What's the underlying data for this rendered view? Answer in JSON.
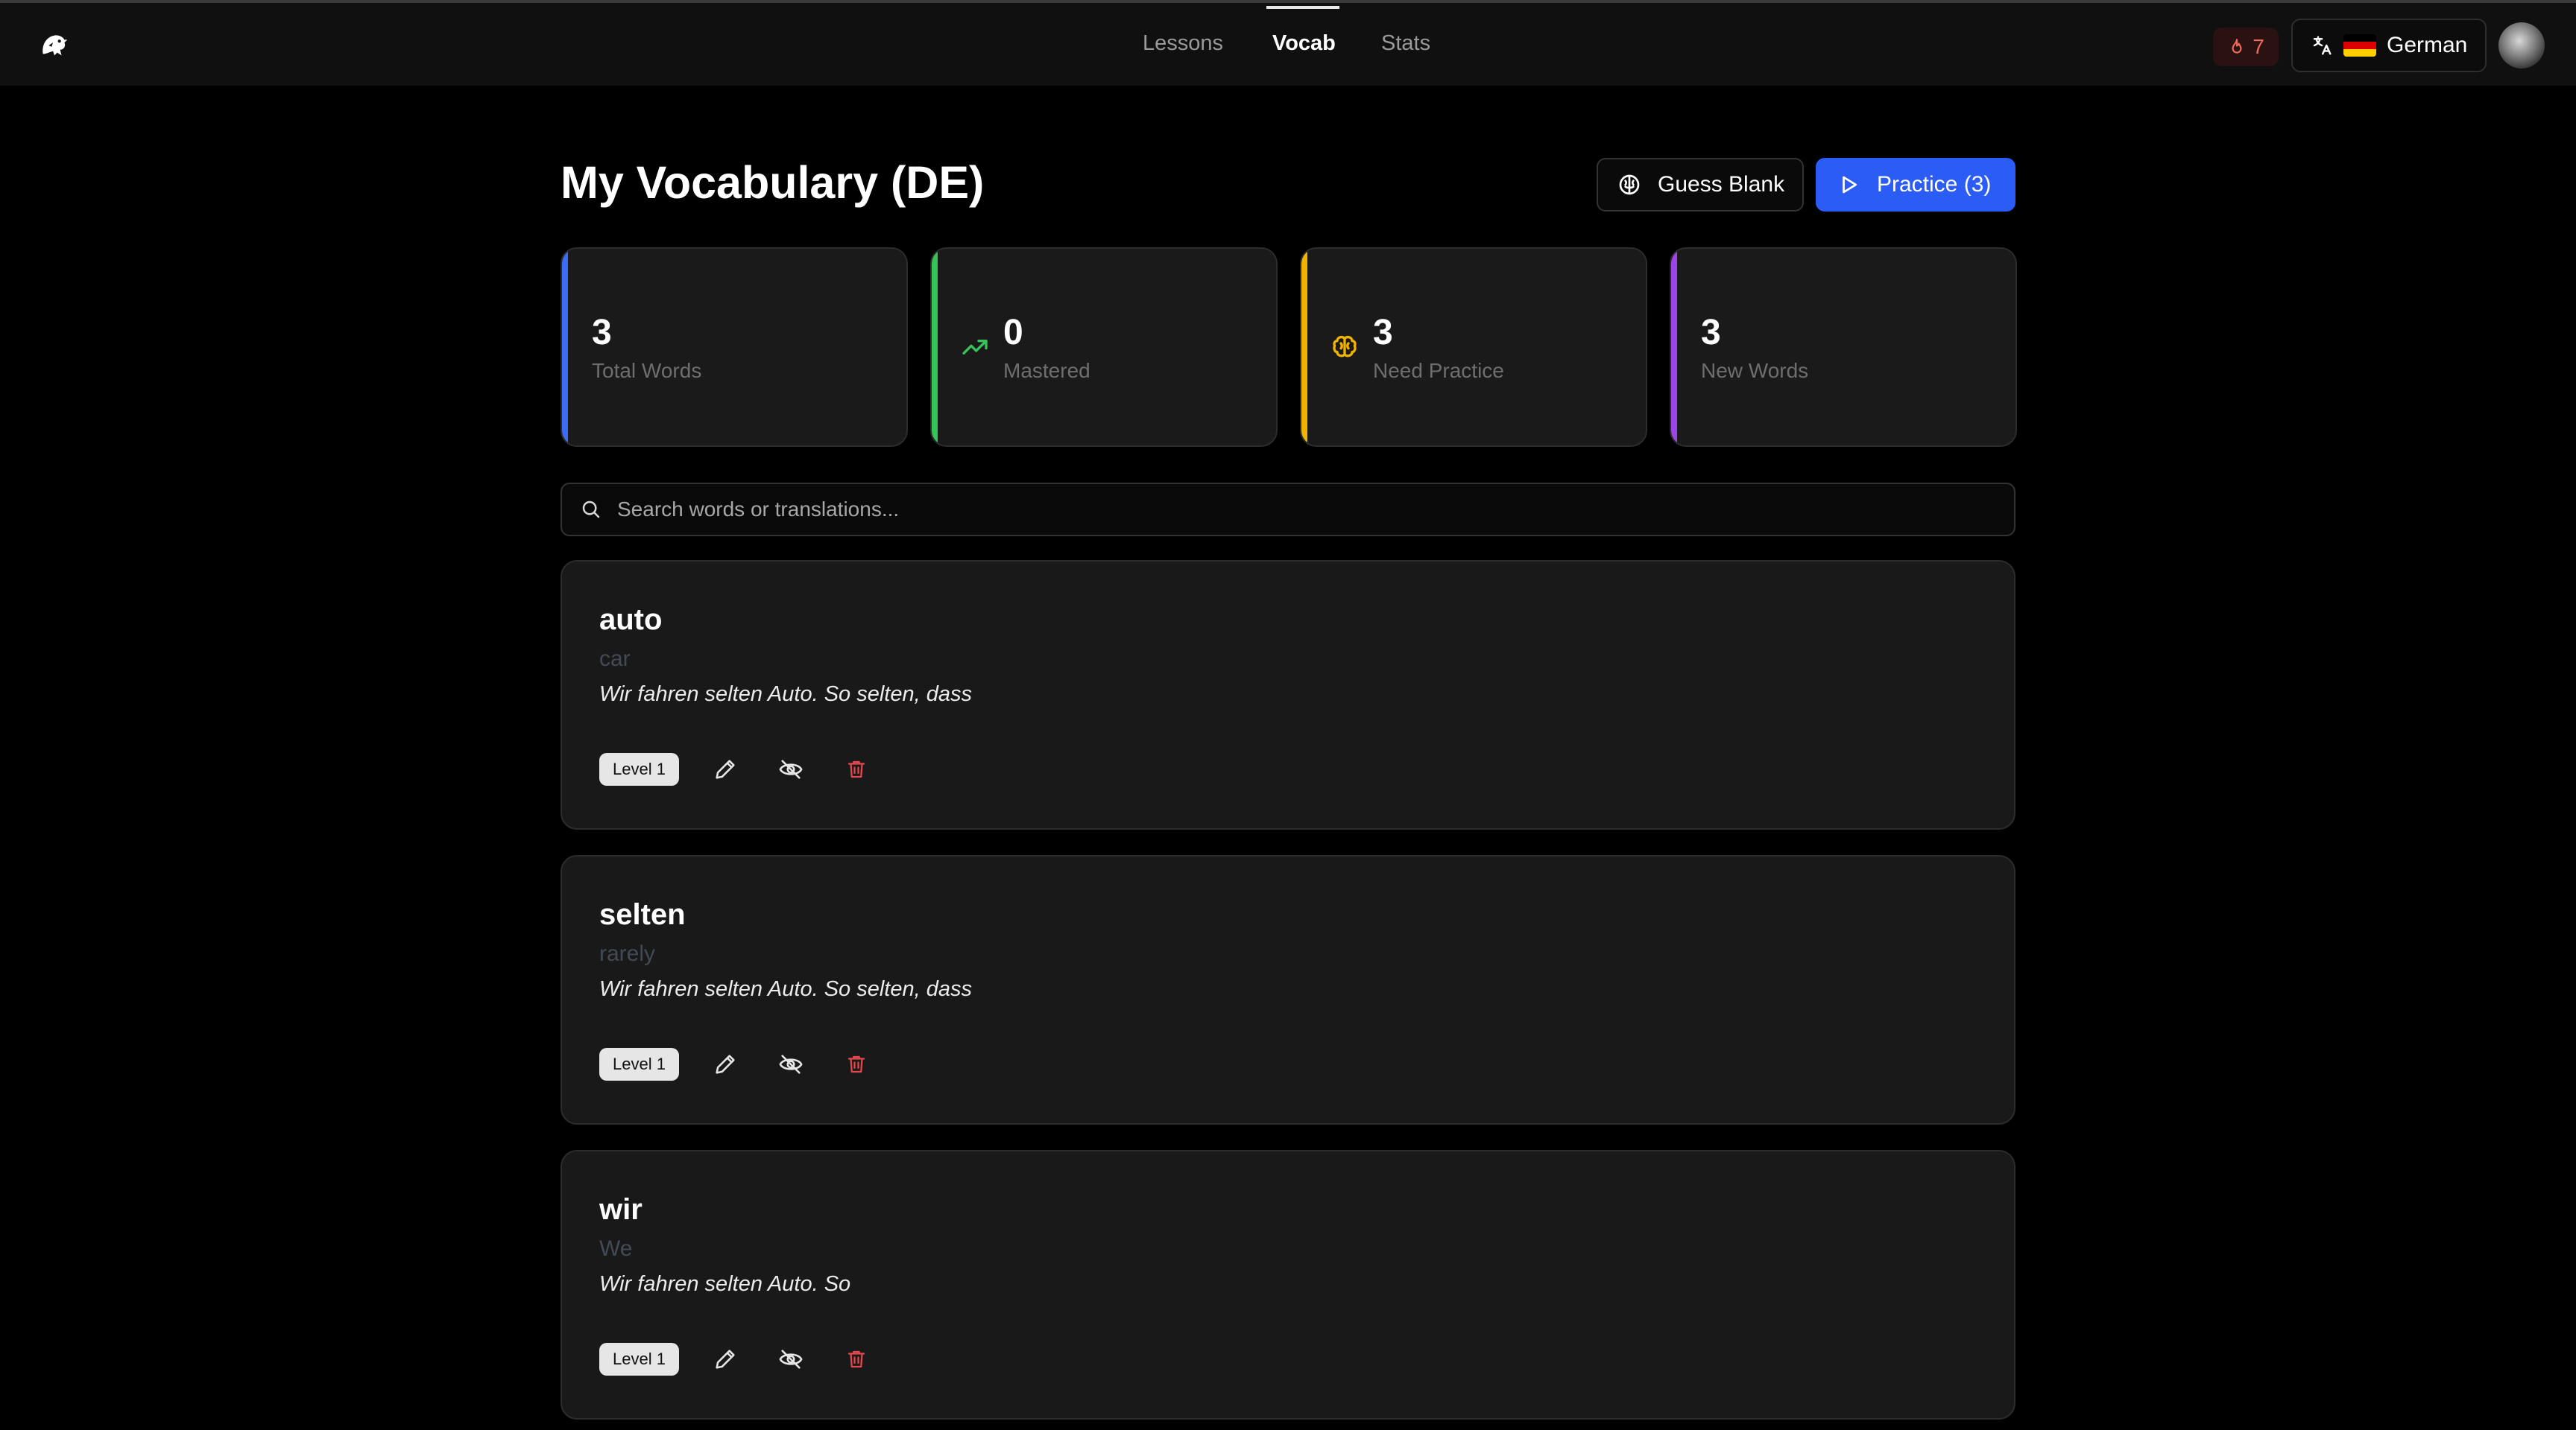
{
  "nav": {
    "items": [
      {
        "label": "Lessons",
        "active": false
      },
      {
        "label": "Vocab",
        "active": true
      },
      {
        "label": "Stats",
        "active": false
      }
    ]
  },
  "header": {
    "streak_count": "7",
    "language": "German",
    "icons": {
      "logo": "dragon-logo-icon",
      "streak": "flame-icon",
      "language": "translate-icon",
      "flag": "german-flag-icon",
      "avatar": "user-avatar"
    }
  },
  "page": {
    "title": "My Vocabulary (DE)",
    "guess_blank_label": "Guess Blank",
    "practice_label": "Practice (3)"
  },
  "stats": [
    {
      "value": "3",
      "label": "Total Words",
      "accent": "#3b6cf6",
      "icon": ""
    },
    {
      "value": "0",
      "label": "Mastered",
      "accent": "#35c45a",
      "icon": "trending-up-icon"
    },
    {
      "value": "3",
      "label": "Need Practice",
      "accent": "#f0b400",
      "icon": "brain-icon"
    },
    {
      "value": "3",
      "label": "New Words",
      "accent": "#9b45e8",
      "icon": ""
    }
  ],
  "search": {
    "placeholder": "Search words or translations...",
    "value": ""
  },
  "words": [
    {
      "word": "auto",
      "translation": "car",
      "example": "Wir fahren selten Auto. So selten, dass",
      "level": "Level 1"
    },
    {
      "word": "selten",
      "translation": "rarely",
      "example": "Wir fahren selten Auto. So selten, dass",
      "level": "Level 1"
    },
    {
      "word": "wir",
      "translation": "We",
      "example": "Wir fahren selten Auto. So",
      "level": "Level 1"
    }
  ],
  "colors": {
    "background": "#000000",
    "card": "#191919",
    "primary": "#2b5cf5",
    "delete": "#e5484d"
  }
}
